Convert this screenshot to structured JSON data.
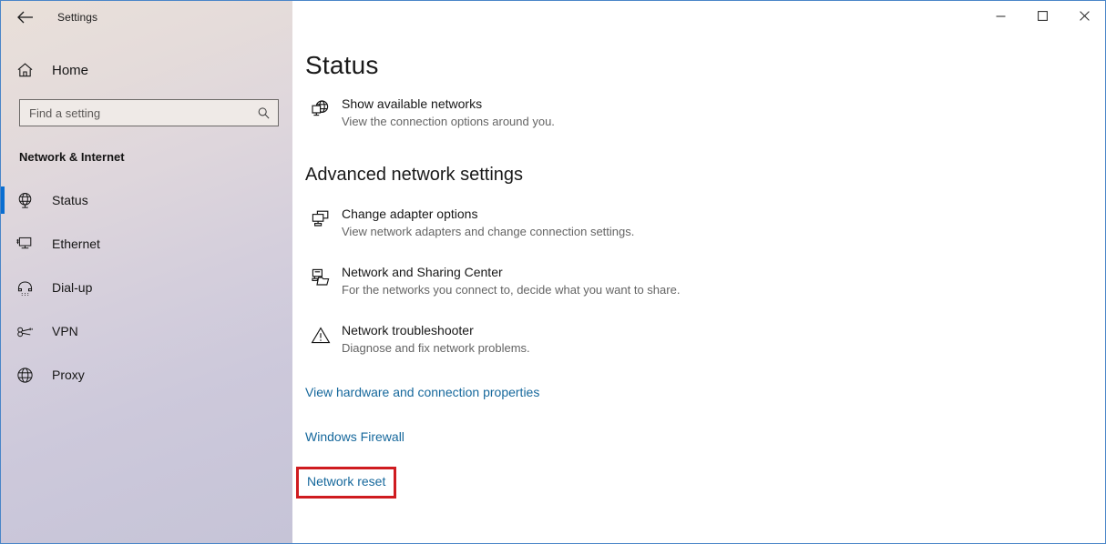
{
  "window": {
    "app_title": "Settings",
    "back_icon": "back-arrow-icon",
    "controls": {
      "minimize": "minimize-icon",
      "maximize": "maximize-icon",
      "close": "close-icon"
    },
    "border_color": "#4a86c8"
  },
  "sidebar": {
    "home": {
      "label": "Home",
      "icon": "home-icon"
    },
    "search": {
      "placeholder": "Find a setting",
      "value": "",
      "icon": "search-icon"
    },
    "category": "Network & Internet",
    "selected_index": 0,
    "accent_color": "#0a6ed1",
    "items": [
      {
        "label": "Status",
        "icon": "globe-monitor-icon",
        "selected": true
      },
      {
        "label": "Ethernet",
        "icon": "ethernet-monitor-icon",
        "selected": false
      },
      {
        "label": "Dial-up",
        "icon": "telephone-icon",
        "selected": false
      },
      {
        "label": "VPN",
        "icon": "vpn-key-icon",
        "selected": false
      },
      {
        "label": "Proxy",
        "icon": "globe-icon",
        "selected": false
      }
    ]
  },
  "main": {
    "page_title": "Status",
    "show_available_networks": {
      "title": "Show available networks",
      "desc": "View the connection options around you.",
      "icon": "globe-monitor-icon"
    },
    "advanced_heading": "Advanced network settings",
    "advanced_items": [
      {
        "title": "Change adapter options",
        "desc": "View network adapters and change connection settings.",
        "icon": "two-monitors-icon"
      },
      {
        "title": "Network and Sharing Center",
        "desc": "For the networks you connect to, decide what you want to share.",
        "icon": "computer-folder-share-icon"
      },
      {
        "title": "Network troubleshooter",
        "desc": "Diagnose and fix network problems.",
        "icon": "warning-triangle-icon"
      }
    ],
    "links": [
      {
        "label": "View hardware and connection properties",
        "highlighted": false
      },
      {
        "label": "Windows Firewall",
        "highlighted": false
      }
    ],
    "highlighted_link": {
      "label": "Network reset",
      "highlight_color": "#cf1b20"
    },
    "link_color": "#16689c"
  }
}
